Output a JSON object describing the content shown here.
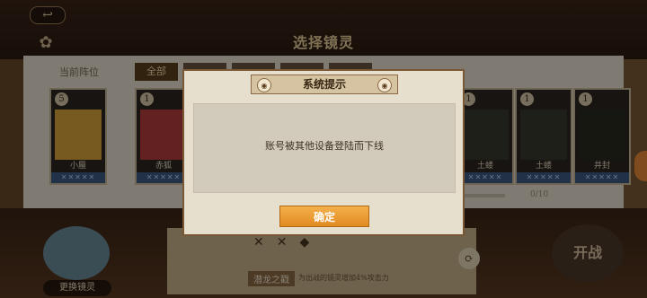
{
  "header": {
    "back_icon": "back-arrow-icon",
    "title": "选择镜灵"
  },
  "formation": {
    "label": "当前阵位",
    "tabs": [
      {
        "label": "全部"
      }
    ]
  },
  "cards": [
    {
      "level": "5",
      "name": "小蜃",
      "stars": "✕✕✕✕✕",
      "art_color": "#d9a43a"
    },
    {
      "level": "1",
      "name": "赤狐",
      "stars": "✕✕✕✕✕",
      "art_color": "#b43c3c"
    },
    {
      "level": "1",
      "name": "土蝼",
      "stars": "✕✕✕✕✕",
      "art_color": "#3a3a2e"
    },
    {
      "level": "1",
      "name": "土蝼",
      "stars": "✕✕✕✕✕",
      "art_color": "#3a3a2e"
    },
    {
      "level": "1",
      "name": "井封",
      "stars": "✕✕✕✕✕",
      "art_color": "#2a2a22"
    }
  ],
  "progress": {
    "text": "0/10"
  },
  "bottom": {
    "change_label": "更换镜灵",
    "skill_name": "潜龙之戳",
    "skill_desc": "为出战的镜灵增加4%攻击力",
    "start_label": "开战"
  },
  "dialog": {
    "title": "系统提示",
    "message": "账号被其他设备登陆而下线",
    "confirm_label": "确定"
  }
}
